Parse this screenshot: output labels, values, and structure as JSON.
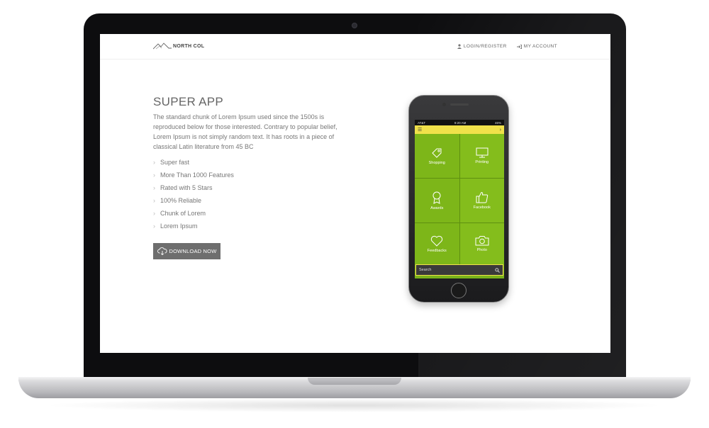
{
  "site": {
    "logo_text": "NORTH COL",
    "nav": [
      {
        "label": "LOGIN/REGISTER",
        "icon": "user-icon"
      },
      {
        "label": "MY ACCOUNT",
        "icon": "sign-in-icon"
      }
    ]
  },
  "hero": {
    "title": "SUPER APP",
    "description": "The standard chunk of Lorem Ipsum used since the 1500s is reproduced below for those interested. Contrary to popular belief, Lorem Ipsum is not simply random text. It has roots in a piece of classical Latin literature from 45 BC",
    "features": [
      "Super fast",
      "More Than 1000 Features",
      "Rated with 5 Stars",
      "100% Reliable",
      "Chunk of Lorem",
      "Lorem Ipsum"
    ],
    "download_label": "DOWNLOAD NOW"
  },
  "phone": {
    "carrier": "AT&T",
    "time": "9:20 AM",
    "battery": "46%",
    "tiles": [
      {
        "label": "Shopping",
        "icon": "tag-icon"
      },
      {
        "label": "Printing",
        "icon": "monitor-icon"
      },
      {
        "label": "Awards",
        "icon": "award-icon"
      },
      {
        "label": "Facebook",
        "icon": "thumbs-up-icon"
      },
      {
        "label": "Feedbacks",
        "icon": "heart-icon"
      },
      {
        "label": "Photo",
        "icon": "camera-icon"
      }
    ],
    "search_placeholder": "Search"
  },
  "colors": {
    "app_green": "#7ab31a",
    "app_yellow": "#f0e14a",
    "button_gray": "#6e6e6e"
  }
}
